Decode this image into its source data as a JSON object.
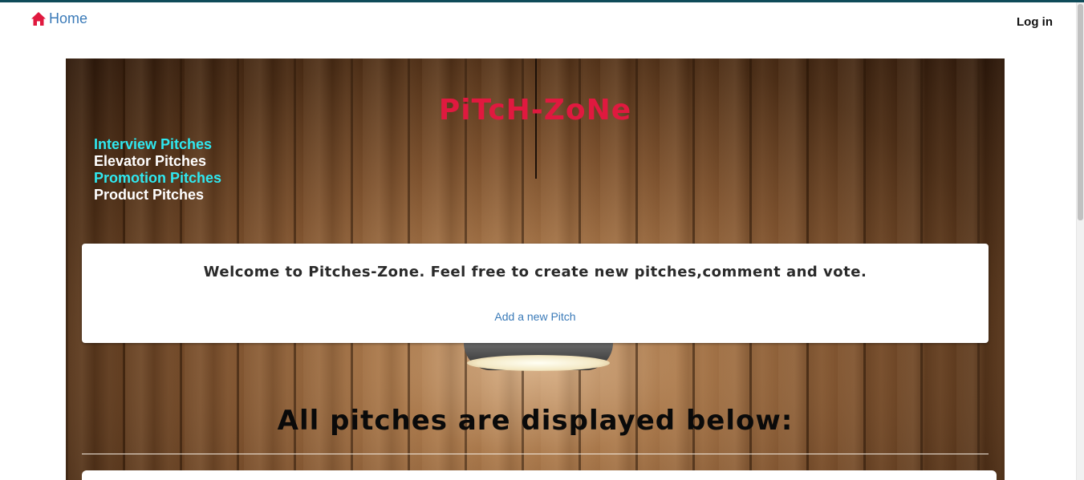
{
  "nav": {
    "home_label": "Home",
    "login_label": "Log in"
  },
  "hero": {
    "brand": "PiTcH-ZoNe",
    "categories": [
      {
        "label": "Interview Pitches",
        "color": "#2fe8f0"
      },
      {
        "label": "Elevator Pitches",
        "color": "#ffffff"
      },
      {
        "label": "Promotion Pitches",
        "color": "#2fe8f0"
      },
      {
        "label": "Product Pitches",
        "color": "#ffffff"
      }
    ]
  },
  "welcome": {
    "text": "Welcome to Pitches-Zone. Feel free to create new pitches,comment and vote.",
    "add_pitch_label": "Add a new Pitch"
  },
  "pitches": {
    "heading": "All pitches are displayed below:"
  },
  "colors": {
    "brand": "#e0193f",
    "link": "#3a7ab8",
    "topline": "#0f4b59"
  },
  "icons": {
    "home": "home-icon"
  }
}
